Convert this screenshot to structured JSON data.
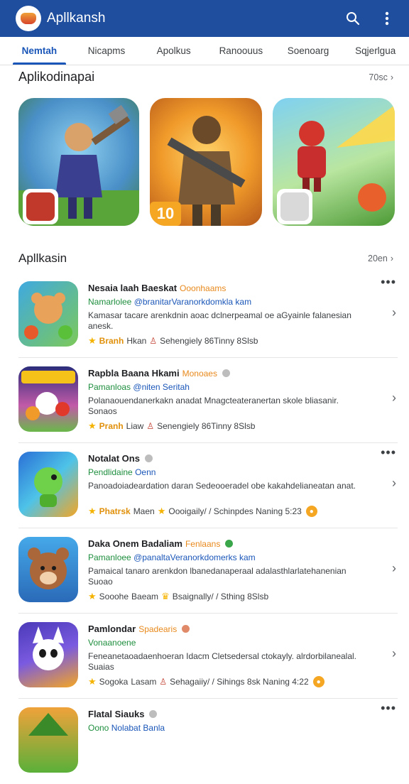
{
  "appbar": {
    "title": "Apllkansh",
    "search_icon": "search-icon",
    "menu_icon": "more-vert-icon"
  },
  "tabs": [
    {
      "label": "Nemtah",
      "active": true
    },
    {
      "label": "Nicapms",
      "active": false
    },
    {
      "label": "Apolkus",
      "active": false
    },
    {
      "label": "Ranoouus",
      "active": false
    },
    {
      "label": "Soenoarg",
      "active": false
    },
    {
      "label": "Sqjerlgua",
      "active": false
    }
  ],
  "featured": {
    "title": "Aplikodinapai",
    "more": "70sc",
    "rank_badge": "10",
    "colors": {
      "accent": "#f5a623"
    }
  },
  "list": {
    "title": "Apllkasin",
    "more": "20en",
    "items": [
      {
        "name": "Nesaia laah Baeskat",
        "tag": "Ooonhaams",
        "dev": "Namarlolee",
        "handle": "@branitarVaranorkdomkla kam",
        "desc": "Kamasar tacare arenkdnin aoac dclnerpeamal oe aGyainle falanesian anesk.",
        "rating": "Branh",
        "stat1": "Hkan",
        "stat2": "Sehengiely 86Tinny 8Slsb",
        "badge": ""
      },
      {
        "name": "Rapbla Baana Hkami",
        "tag": "Monoaes",
        "dev": "Pamanloas",
        "handle": "@niten Seritah",
        "desc": "Polanaouendanerkakn anadat Mnagcteateranertan skole bliasanir. Sonaos",
        "rating": "Pranh",
        "stat1": "Liaw",
        "stat2": "Senengiely 86Tinny 8Slsb",
        "badge": ""
      },
      {
        "name": "Notalat Ons",
        "tag": "",
        "dev": "Pendlidaine",
        "handle": "Oenn",
        "desc": "Panoadoiadeardation daran Sedeooeradel obe kakahdelianeatan anat.",
        "rating": "Phatrsk",
        "stat1": "Maen",
        "stat2": "Oooigaily/ / Schinpdes Naning 5:23",
        "badge": "●"
      },
      {
        "name": "Daka Onem Badaliam",
        "tag": "Fenlaans",
        "dev": "Pamanloee",
        "handle": "@panaltaVeranorkdomerks kam",
        "desc": "Pamaical tanaro arenkdon lbanedanaperaal adalasthlarlatehanenian Suoao",
        "rating": "Sooohe",
        "stat1": "Baeam",
        "stat2": "Bsaignally/ / Sthing 8Slsb",
        "badge": ""
      },
      {
        "name": "Pamlondar",
        "tag": "Spadearis",
        "dev": "Vonaanoene",
        "handle": "",
        "desc": "Feneanetaoadaenhoeran Idacm Cletsedersal ctokayly. alrdorbilanealal. Suaias",
        "rating": "Sogoka",
        "stat1": "Lasam",
        "stat2": "Sehagaiiy/ / Sihings 8sk Naning 4:22",
        "badge": "●"
      },
      {
        "name": "Flatal Siauks",
        "tag": "",
        "dev": "Oono",
        "handle": "Nolabat Banla",
        "desc": "",
        "rating": "",
        "stat1": "",
        "stat2": "",
        "badge": ""
      }
    ]
  }
}
